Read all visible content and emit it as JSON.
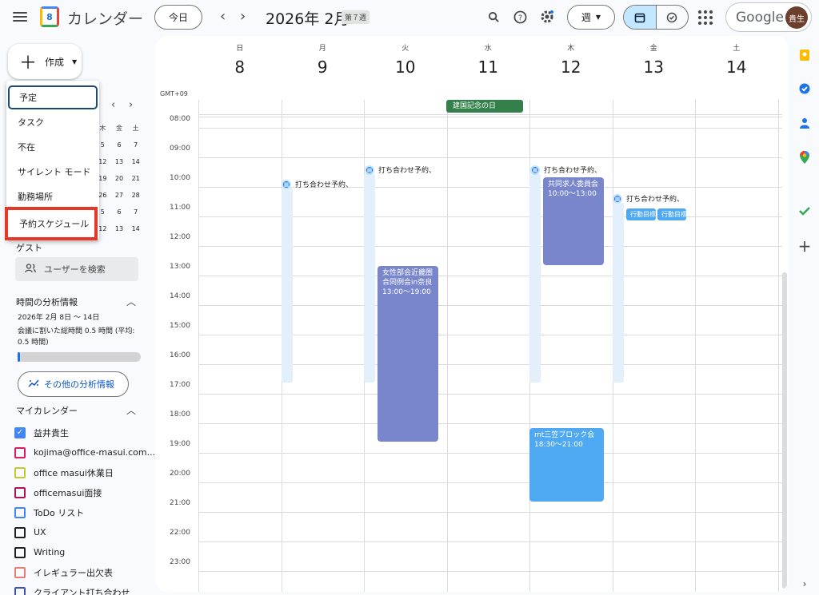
{
  "header": {
    "app_title": "カレンダー",
    "logo_num": "8",
    "today": "今日",
    "month": "2026年 2月",
    "week_badge": "第７週",
    "view_label": "週",
    "google": "Google",
    "avatar": "貴生"
  },
  "sidebar": {
    "create_label": "作成",
    "menu": [
      "予定",
      "タスク",
      "不在",
      "サイレント モード",
      "勤務場所",
      "予約スケジュール"
    ],
    "mini_cal": {
      "weekday_heads": [
        "木",
        "金",
        "土"
      ],
      "rows": [
        [
          "5",
          "6",
          "7"
        ],
        [
          "12",
          "13",
          "14"
        ],
        [
          "19",
          "20",
          "21"
        ],
        [
          "26",
          "27",
          "28"
        ],
        [
          "5",
          "6",
          "7"
        ],
        [
          "12",
          "13",
          "14"
        ]
      ]
    },
    "guest_label": "ゲスト",
    "user_search": "ユーザーを検索",
    "analysis_title": "時間の分析情報",
    "analysis_range": "2026年 2月 8日 〜 14日",
    "analysis_text": "会議に割いた総時間 0.5 時間 (平均: 0.5 時間)",
    "analysis_progress": 0.02,
    "more_button": "その他の分析情報",
    "my_cal_title": "マイカレンダー",
    "calendars": [
      {
        "name": "益井貴生",
        "color": "#4285f4",
        "checked": true
      },
      {
        "name": "kojima@office-masui.com...",
        "color": "#d81b60",
        "checked": false
      },
      {
        "name": "office masui休業日",
        "color": "#c0ca33",
        "checked": false
      },
      {
        "name": "officemasui面接",
        "color": "#ad1457",
        "checked": false
      },
      {
        "name": "ToDo リスト",
        "color": "#4285f4",
        "checked": false
      },
      {
        "name": "UX",
        "color": "#202124",
        "checked": false
      },
      {
        "name": "Writing",
        "color": "#202124",
        "checked": false
      },
      {
        "name": "イレギュラー出欠表",
        "color": "#e67c73",
        "checked": false
      },
      {
        "name": "クライアント打ち合わせ",
        "color": "#3f51b5",
        "checked": false
      }
    ]
  },
  "calendar": {
    "timezone": "GMT+09",
    "days": [
      {
        "dow": "日",
        "num": "8"
      },
      {
        "dow": "月",
        "num": "9"
      },
      {
        "dow": "火",
        "num": "10"
      },
      {
        "dow": "水",
        "num": "11"
      },
      {
        "dow": "木",
        "num": "12"
      },
      {
        "dow": "金",
        "num": "13"
      },
      {
        "dow": "土",
        "num": "14"
      }
    ],
    "times": [
      "08:00",
      "09:00",
      "10:00",
      "11:00",
      "12:00",
      "13:00",
      "14:00",
      "15:00",
      "16:00",
      "17:00",
      "18:00",
      "19:00",
      "20:00",
      "21:00",
      "22:00",
      "23:00"
    ],
    "allday_event": "建国記念の日",
    "booking_label": "打ち合わせ予約、",
    "events": {
      "tue": {
        "title": "女性部会近畿圏合同例会in奈良",
        "time": "13:00〜19:00"
      },
      "thu1": {
        "title": "共同求人委員会",
        "time": "10:00〜13:00"
      },
      "thu2": {
        "title": "mt三笠ブロック会",
        "time": "18:30〜21:00"
      },
      "fri_mini": [
        "行動目標",
        "行動目標"
      ]
    }
  },
  "colors": {
    "accent": "#1a73e8",
    "event_purple": "#7986cb",
    "event_blue": "#4fa8f2",
    "holiday_green": "#33804a",
    "highlight_red": "#e53826"
  }
}
